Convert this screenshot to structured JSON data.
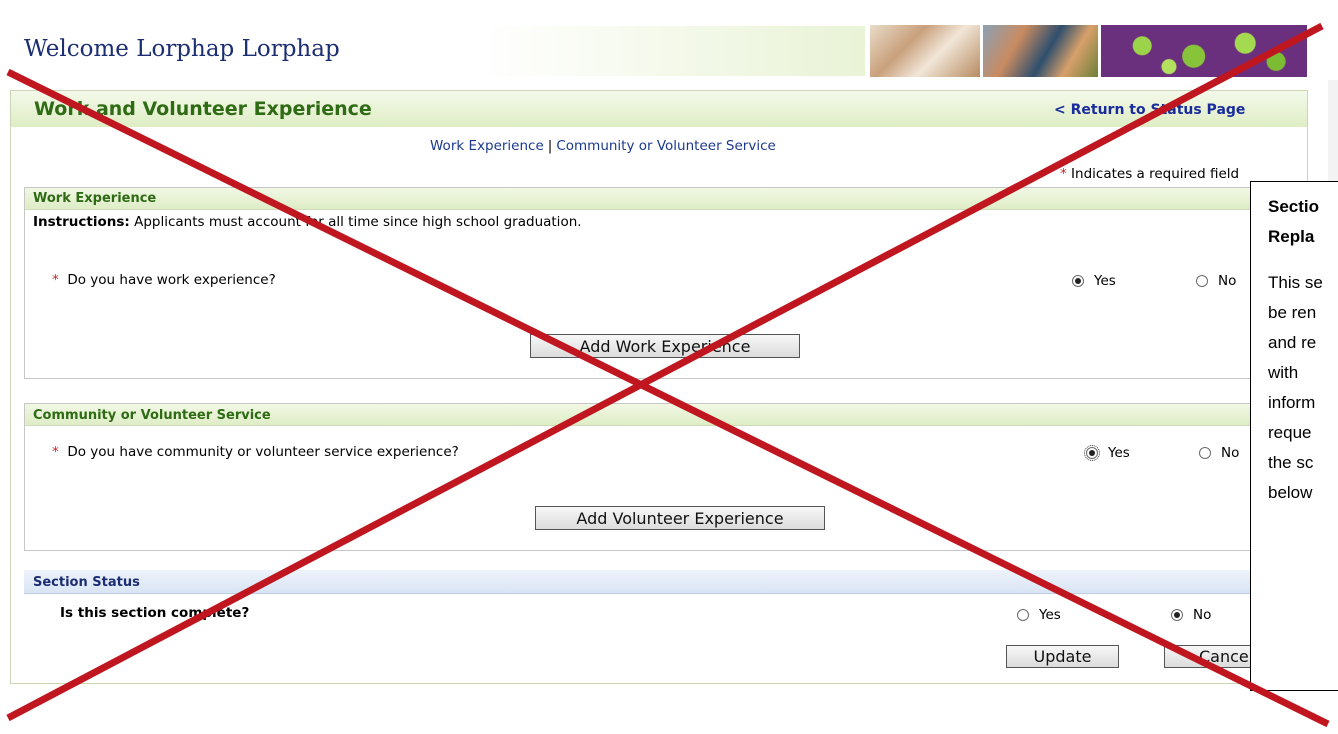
{
  "header": {
    "welcome_text": "Welcome Lorphap Lorphap"
  },
  "panel": {
    "title": "Work and Volunteer Experience",
    "return_link": "< Return to Status Page",
    "subnav": [
      "Work Experience",
      "Community or Volunteer Service"
    ],
    "subnav_separator": "|",
    "required_star": "*",
    "required_note": "Indicates a required field"
  },
  "work_section": {
    "title": "Work Experience",
    "instructions_label": "Instructions:",
    "instructions_text": "Applicants must account for all time since high school graduation.",
    "question": "Do you have work experience?",
    "yes_label": "Yes",
    "no_label": "No",
    "selected": "Yes",
    "add_button": "Add Work Experience"
  },
  "volunteer_section": {
    "title": "Community or Volunteer Service",
    "question": "Do you have community or volunteer service experience?",
    "yes_label": "Yes",
    "no_label": "No",
    "selected": "Yes",
    "add_button": "Add Volunteer Experience"
  },
  "status_section": {
    "title": "Section Status",
    "question": "Is this section complete?",
    "yes_label": "Yes",
    "no_label": "No",
    "selected": "No"
  },
  "actions": {
    "update": "Update",
    "cancel": "Cancel"
  },
  "overlay_note": {
    "title_line1": "Sectio",
    "title_line2": "Repla",
    "body_lines": [
      "This se",
      "be ren",
      "and re",
      "with",
      "inform",
      "reque",
      "the sc",
      "below"
    ]
  },
  "colors": {
    "cross_red": "#c0161f",
    "section_green": "#2e6b14",
    "link_blue": "#1a2c9c"
  }
}
